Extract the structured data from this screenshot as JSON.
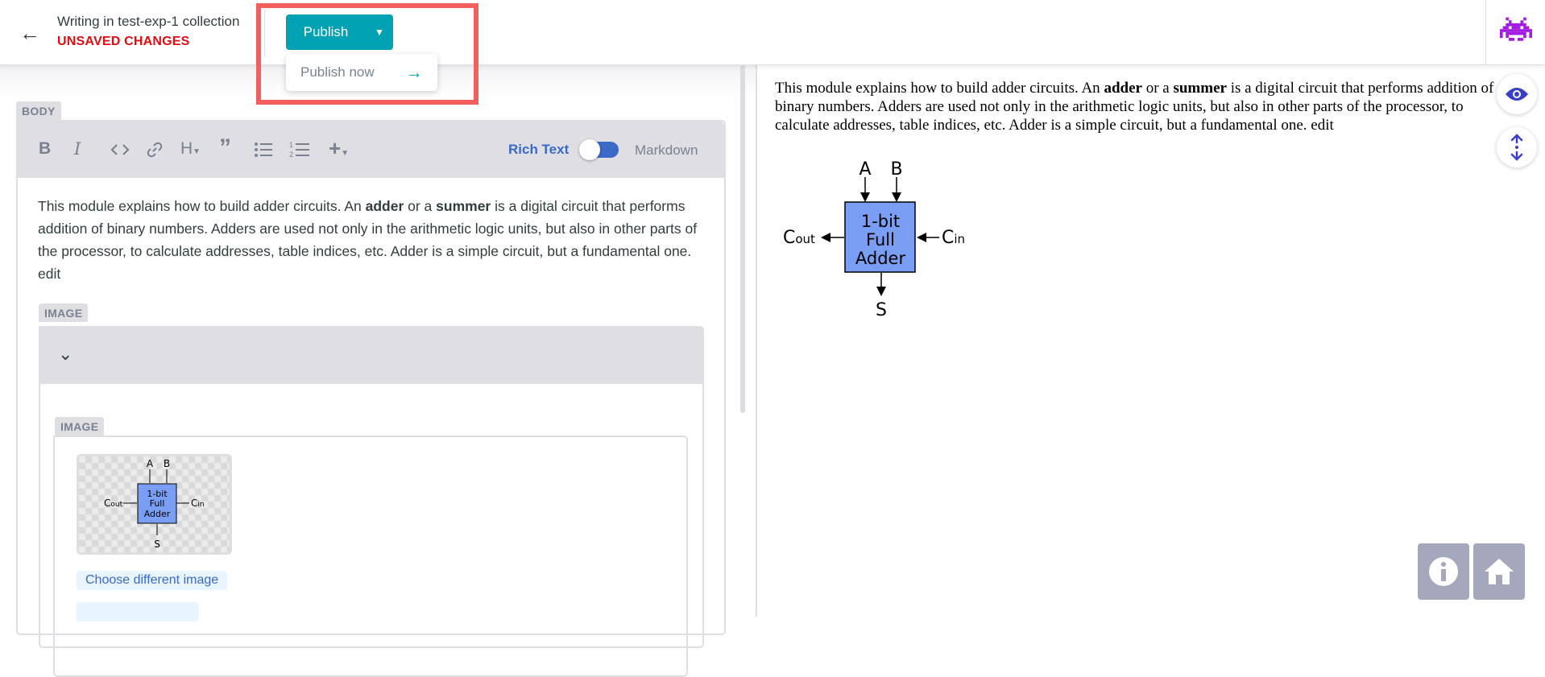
{
  "header": {
    "back_icon": "arrow-left-icon",
    "collection_title": "Writing in test-exp-1 collection",
    "status": "UNSAVED CHANGES",
    "publish_label": "Publish",
    "publish_menu_item": "Publish now",
    "avatar_icon": "space-invader-icon"
  },
  "editor": {
    "body_label": "BODY",
    "toolbar": {
      "buttons": [
        "bold-icon",
        "italic-icon",
        "code-icon",
        "link-icon",
        "heading-icon",
        "quote-icon",
        "bulleted-list-icon",
        "numbered-list-icon",
        "add-component-icon"
      ],
      "rich_text_label": "Rich Text",
      "markdown_label": "Markdown",
      "mode": "Rich Text"
    },
    "body_text": {
      "t1": "This module explains how to build adder circuits. An ",
      "b1": "adder",
      "t2": " or a ",
      "b2": "summer",
      "t3": " is a digital circuit that performs addition of binary numbers. Adders are used not only in the arithmetic logic units, but also in other parts of the processor, to calculate addresses, table indices, etc. Adder is a simple circuit, but a fundamental one. edit"
    },
    "image_widget_label": "IMAGE",
    "image_field_label": "IMAGE",
    "choose_image_label": "Choose different image"
  },
  "diagram": {
    "input_a": "A",
    "input_b": "B",
    "block_line1": "1-bit",
    "block_line2": "Full",
    "block_line3": "Adder",
    "carry_out": "C",
    "carry_out_sub": "out",
    "carry_in": "C",
    "carry_in_sub": "in",
    "sum": "S",
    "block_color": "#7b9ef5"
  },
  "preview": {
    "t1": "This module explains how to build adder circuits. An ",
    "b1": "adder",
    "t2": " or a ",
    "b2": "summer",
    "t3": " is a digital circuit that performs addition of binary numbers. Adders are used not only in the arithmetic logic units, but also in other parts of the processor, to calculate addresses, table indices, etc. Adder is a simple circuit, but a fundamental one. edit",
    "eye_icon": "eye-icon",
    "sync_icon": "sync-scroll-icon"
  },
  "corner": {
    "info_icon": "info-icon",
    "home_icon": "home-icon"
  },
  "colors": {
    "accent": "#00a1b3",
    "unsaved": "#e00d12",
    "highlight": "#f25f5c",
    "link": "#3a69c7"
  }
}
